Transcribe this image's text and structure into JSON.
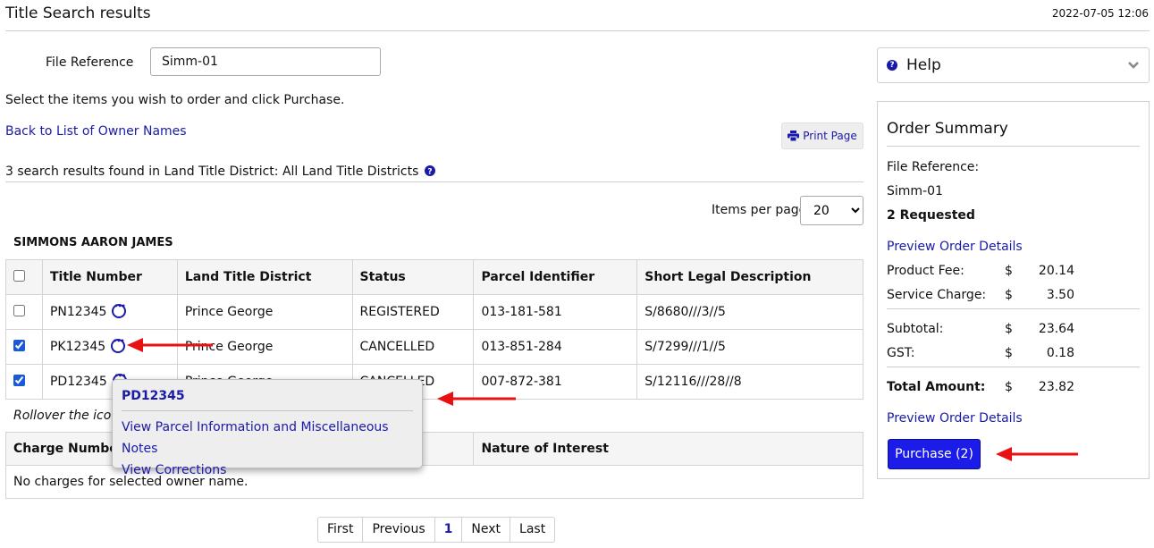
{
  "header": {
    "title": "Title Search results",
    "timestamp": "2022-07-05 12:06"
  },
  "file_reference": {
    "label": "File Reference",
    "value": "Simm-01"
  },
  "instruction": "Select the items you wish to order and click Purchase.",
  "back_link": "Back to List of Owner Names",
  "print_button": {
    "label": "Print Page",
    "icon": "printer-icon"
  },
  "results_count": "3 search results found in Land Title District: All Land Title Districts",
  "items_per_page": {
    "label": "Items per page",
    "selected": "20"
  },
  "owner_name": "SIMMONS AARON JAMES",
  "results_table": {
    "headers": [
      "Title Number",
      "Land Title District",
      "Status",
      "Parcel Identifier",
      "Short Legal Description"
    ],
    "rows": [
      {
        "checked": false,
        "title": "PN12345",
        "district": "Prince George",
        "status": "REGISTERED",
        "pid": "013-181-581",
        "legal": "S/8680///3//5"
      },
      {
        "checked": true,
        "title": "PK12345",
        "district": "Prince George",
        "status": "CANCELLED",
        "pid": "013-851-284",
        "legal": "S/7299///1//5"
      },
      {
        "checked": true,
        "title": "PD12345",
        "district": "Prince George",
        "status": "CANCELLED",
        "pid": "007-872-381",
        "legal": "S/12116///28//8"
      }
    ]
  },
  "rollover_note": "Rollover the icon a",
  "charges_table": {
    "headers": [
      "Charge Number",
      "Nature of Interest"
    ],
    "empty_message": "No charges for selected owner name."
  },
  "popover": {
    "title": "PD12345",
    "links": [
      "View Parcel Information and Miscellaneous Notes",
      "View Corrections"
    ]
  },
  "pagination": {
    "first": "First",
    "previous": "Previous",
    "current": "1",
    "next": "Next",
    "last": "Last"
  },
  "help_panel": {
    "title": "Help"
  },
  "order_summary": {
    "title": "Order Summary",
    "file_ref_label": "File Reference:",
    "file_ref_value": "Simm-01",
    "requested": "2 Requested",
    "preview_link": "Preview Order Details",
    "currency": "$",
    "product_fee": {
      "label": "Product Fee:",
      "amount": "20.14"
    },
    "service_charge": {
      "label": "Service Charge:",
      "amount": "3.50"
    },
    "subtotal": {
      "label": "Subtotal:",
      "amount": "23.64"
    },
    "gst": {
      "label": "GST:",
      "amount": "0.18"
    },
    "total": {
      "label": "Total Amount:",
      "amount": "23.82"
    },
    "purchase_button": "Purchase (2)"
  },
  "colors": {
    "link": "#1a1aa8",
    "purchase_button": "#1c1ce8",
    "annotation_arrow": "#e81010"
  }
}
